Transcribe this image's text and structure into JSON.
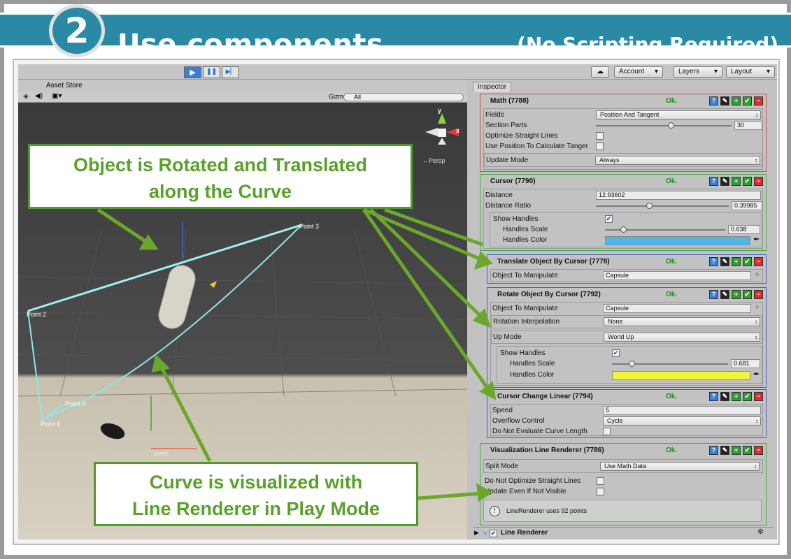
{
  "banner": {
    "number": "2",
    "title": "Use components",
    "subtitle": "(No Scripting Required)"
  },
  "toolbar": {
    "play": "▶",
    "pause": "❚❚",
    "step": "▶▏",
    "account": "Account",
    "layers": "Layers",
    "layout": "Layout",
    "dropdown_arrow": "▾",
    "cloud": "☁"
  },
  "scene": {
    "asset_store_tab": "Asset Store",
    "gizmos": "Gizmos",
    "search_placeholder": "All",
    "persp": "←Persp",
    "axis_y": "y",
    "axis_x": "x",
    "points": [
      "Point 3",
      "Point 2",
      "Point 0",
      "Point 1"
    ],
    "static_label": "Static"
  },
  "callouts": {
    "top": [
      "Object is Rotated and Translated",
      "along the Curve"
    ],
    "bottom": [
      "Curve is visualized with",
      "Line Renderer in Play Mode"
    ]
  },
  "inspector": {
    "tab": "Inspector",
    "ok": "Ok.",
    "math": {
      "title": "Math (7788)",
      "fields_label": "Fields",
      "fields_value": "Position And Tangent",
      "section_parts_label": "Section Parts",
      "section_parts_value": "30",
      "section_parts_slider": 0.55,
      "optimize_label": "Optimize Straight Lines",
      "use_position_label": "Use Position To Calculate Tanger",
      "update_mode_label": "Update Mode",
      "update_mode_value": "Always"
    },
    "cursor": {
      "title": "Cursor (7790)",
      "distance_label": "Distance",
      "distance_value": "12.93602",
      "ratio_label": "Distance Ratio",
      "ratio_value": "0.39985",
      "ratio_slider": 0.4,
      "show_handles_label": "Show Handles",
      "show_handles_checked": "✔",
      "handles_scale_label": "Handles Scale",
      "handles_scale_value": "0.638",
      "handles_scale_slider": 0.15,
      "handles_color_label": "Handles Color",
      "handles_color": "#4fb6e8"
    },
    "translate": {
      "title": "Translate Object By Cursor (7778)",
      "object_label": "Object To Manipulate",
      "object_value": "Capsule"
    },
    "rotate": {
      "title": "Rotate Object By Cursor (7792)",
      "object_label": "Object To Manipulate",
      "object_value": "Capsule",
      "interp_label": "Rotation Interpolation",
      "interp_value": "None",
      "upmode_label": "Up Mode",
      "upmode_value": "World Up",
      "show_handles_label": "Show Handles",
      "show_handles_checked": "✔",
      "handles_scale_label": "Handles Scale",
      "handles_scale_value": "0.681",
      "handles_scale_slider": 0.17,
      "handles_color_label": "Handles Color",
      "handles_color": "#f0f53a"
    },
    "cursor_change": {
      "title": "Cursor Change Linear (7794)",
      "speed_label": "Speed",
      "speed_value": "5",
      "overflow_label": "Overflow Control",
      "overflow_value": "Cycle",
      "no_eval_label": "Do Not Evaluate Curve Length"
    },
    "viz": {
      "title": "Visualization Line Renderer (7786)",
      "split_label": "Split Mode",
      "split_value": "Use Math Data",
      "no_opt_label": "Do Not Optimize Straight Lines",
      "update_label": "Update Even If Not Visible",
      "info": "LineRenderer uses 92 points"
    },
    "line_renderer": {
      "title": "Line Renderer"
    },
    "icon_help": "?",
    "icon_add": "+",
    "icon_ok": "✔",
    "icon_remove": "−",
    "icon_edit": "✎",
    "icon_circle": "○",
    "icon_pick": "✒",
    "icon_info": "!"
  },
  "colors": {
    "banner": "#2a8aa6",
    "accent_green": "#5aa12c",
    "math_border": "#d64b4b",
    "green_border": "#3fae3f",
    "blue_border": "#4a5bd0"
  }
}
